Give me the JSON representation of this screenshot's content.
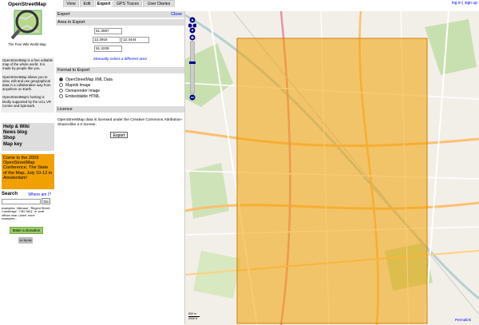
{
  "sidebar": {
    "logo_title": "OpenStreetMap",
    "logo_subtitle": "The Free Wiki World Map",
    "intro_1": "OpenStreetMap is a free editable map of the whole world. It is made by people like you.",
    "intro_2": "OpenStreetMap allows you to view, edit and use geographical data in a collaborative way from anywhere on Earth.",
    "intro_3": "OpenStreetMap's hosting is kindly supported by the UCL VR Centre and bytemark.",
    "help_links": [
      "Help & Wiki",
      "News blog",
      "Shop",
      "Map key"
    ],
    "notice": "Come to the 2009 OpenStreetMap Conference, The State of the Map, July 10-12 in Amsterdam!",
    "search_label": "Search",
    "where_am_i": "Where am I?",
    "search_value": "",
    "go_label": "Go",
    "search_help": "examples: 'Alkmaar', 'Regent Street, Cambridge', 'CB2 5AQ', or 'post offices near Lünen' more examples...",
    "donate_label": "Make a Donation",
    "cc_label": "cc by-sa"
  },
  "tabs": [
    "View",
    "Edit",
    "Export",
    "GPS Traces",
    "User Diaries"
  ],
  "active_tab": "Export",
  "user_links": "log in | sign up",
  "export": {
    "title": "Export",
    "close": "Close",
    "area_heading": "Area to Export",
    "max_lat": "51.3697",
    "min_lon": "12.3916",
    "max_lon": "12.4444",
    "min_lat": "51.3226",
    "manual_link": "Manually select a different area",
    "format_heading": "Format to Export",
    "formats": [
      "OpenStreetMap XML Data",
      "Mapnik Image",
      "Osmarender Image",
      "Embeddable HTML"
    ],
    "selected_format_index": 0,
    "licence_heading": "Licence",
    "licence_text": "OpenStreetMap data is licensed under the Creative Commons Attribution-ShareAlike 2.0 license.",
    "export_button": "Export"
  },
  "map": {
    "attribution": "Permalink",
    "scale_top": "500 m",
    "scale_bottom": "2000 ft",
    "selection_color": "#f0a000",
    "land_color": "#f2efe9"
  }
}
